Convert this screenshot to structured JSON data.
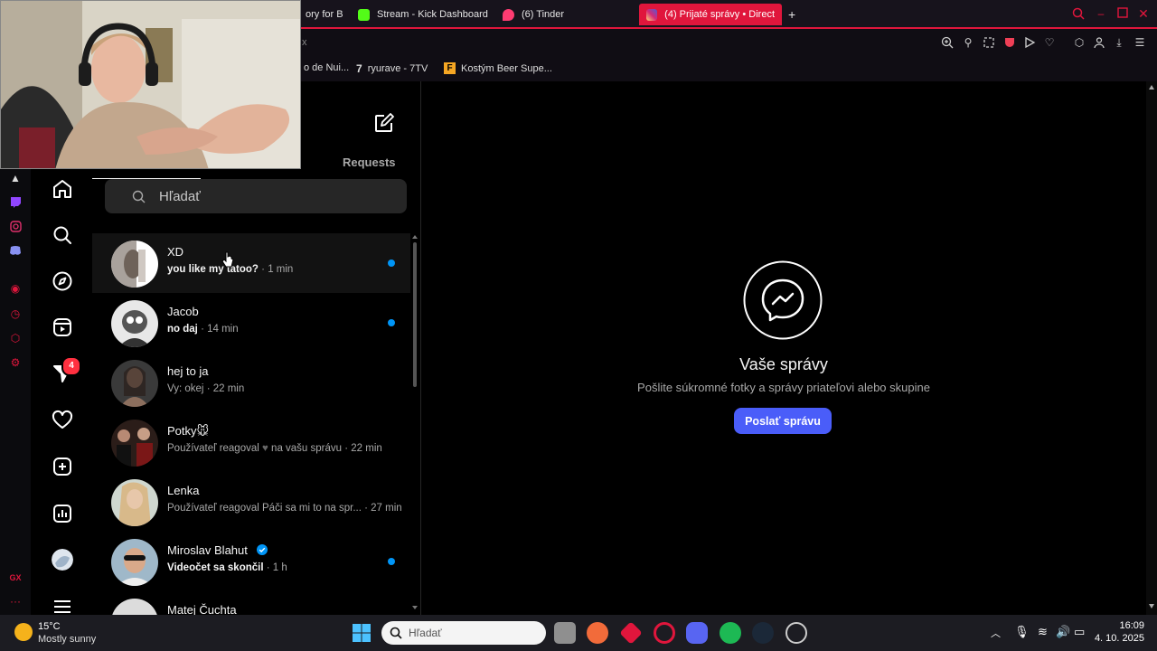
{
  "browser": {
    "tabs": [
      {
        "label": "ory for B",
        "active": false
      },
      {
        "label": "Stream - Kick Dashboard",
        "active": false
      },
      {
        "label": "(6) Tinder",
        "active": false
      },
      {
        "label": "(4) Prijaté správy • Direct",
        "active": true
      }
    ],
    "address_fragment": "x",
    "bookmarks": [
      "o de Nui...",
      "ryurave - 7TV",
      "Kostým Beer Supe..."
    ],
    "gx_label": "GX"
  },
  "nav": {
    "notification_count": "4"
  },
  "inbox": {
    "requests_label": "Requests",
    "search_placeholder": "Hľadať",
    "conversations": [
      {
        "name": "XD",
        "message": "you like my tatoo?",
        "time": "· 1 min",
        "unread": true
      },
      {
        "name": "Jacob",
        "message": "no daj",
        "time": "· 14 min",
        "unread": true
      },
      {
        "name": "hej to ja",
        "message": "Vy: okej",
        "time": "· 22 min",
        "unread": false
      },
      {
        "name": "Potky🐭",
        "message_prefix": "Používateľ reagoval",
        "message_suffix": "na vašu správu",
        "time": "· 22 min",
        "unread": false
      },
      {
        "name": "Lenka",
        "message": "Používateľ reagoval Páči sa mi to na spr...",
        "time": "· 27 min",
        "unread": false
      },
      {
        "name": "Miroslav Blahut",
        "message": "Videočet sa skončil",
        "time": "· 1 h",
        "unread": true,
        "verified": true
      },
      {
        "name": "Matej Čuchta",
        "message": "",
        "time": "",
        "unread": false
      }
    ]
  },
  "main": {
    "title": "Vaše správy",
    "subtitle": "Pošlite súkromné fotky a správy priateľovi alebo skupine",
    "button_label": "Poslať správu"
  },
  "taskbar": {
    "weather_temp": "15°C",
    "weather_desc": "Mostly sunny",
    "search_placeholder": "Hľadať",
    "time": "16:09",
    "date": "4. 10. 2025"
  },
  "colors": {
    "accent": "#e0163c",
    "unread_dot": "#0095f6",
    "button": "#4a5df9"
  }
}
